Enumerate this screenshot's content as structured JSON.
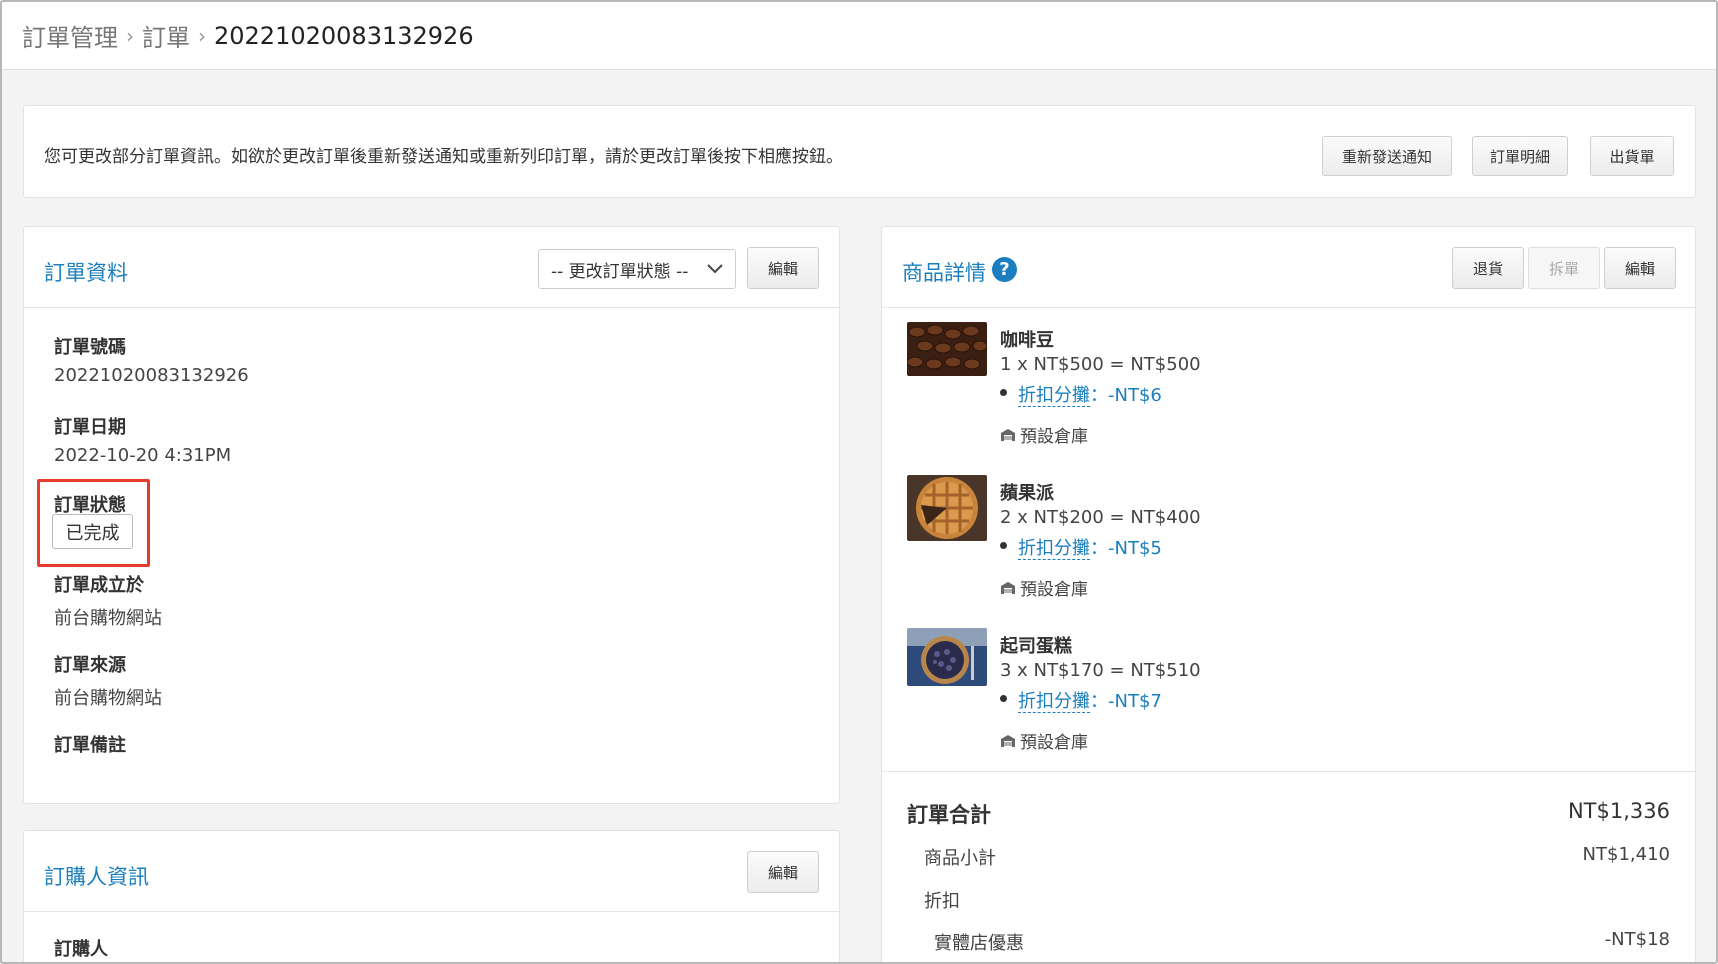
{
  "breadcrumb": {
    "items": [
      "訂單管理",
      "訂單"
    ],
    "current": "20221020083132926"
  },
  "notice": {
    "text": "您可更改部分訂單資訊。如欲於更改訂單後重新發送通知或重新列印訂單，請於更改訂單後按下相應按鈕。",
    "buttons": {
      "resend": "重新發送通知",
      "details": "訂單明細",
      "shipping": "出貨單"
    }
  },
  "order_info": {
    "title": "訂單資料",
    "status_select": "-- 更改訂單狀態 --",
    "edit_label": "編輯",
    "fields": {
      "number_label": "訂單號碼",
      "number_value": "20221020083132926",
      "date_label": "訂單日期",
      "date_value": "2022-10-20 4:31PM",
      "status_label": "訂單狀態",
      "status_value": "已完成",
      "created_label": "訂單成立於",
      "created_value": "前台購物網站",
      "source_label": "訂單來源",
      "source_value": "前台購物網站",
      "remark_label": "訂單備註"
    }
  },
  "buyer_info": {
    "title": "訂購人資訊",
    "edit_label": "編輯",
    "buyer_label": "訂購人"
  },
  "products": {
    "title": "商品詳情",
    "buttons": {
      "return": "退貨",
      "split": "拆單",
      "edit": "編輯"
    },
    "items": [
      {
        "name": "咖啡豆",
        "calc": "1 x NT$500 = NT$500",
        "discount_label": "折扣分攤",
        "discount_value": "：-NT$6",
        "warehouse": "預設倉庫",
        "thumb": "coffee-beans"
      },
      {
        "name": "蘋果派",
        "calc": "2 x NT$200 = NT$400",
        "discount_label": "折扣分攤",
        "discount_value": "：-NT$5",
        "warehouse": "預設倉庫",
        "thumb": "apple-pie"
      },
      {
        "name": "起司蛋糕",
        "calc": "3 x NT$170 = NT$510",
        "discount_label": "折扣分攤",
        "discount_value": "：-NT$7",
        "warehouse": "預設倉庫",
        "thumb": "cheesecake"
      }
    ]
  },
  "summary": {
    "total_label": "訂單合計",
    "total_value": "NT$1,336",
    "subtotal_label": "商品小計",
    "subtotal_value": "NT$1,410",
    "discount_label": "折扣",
    "store_discount_label": "實體店優惠",
    "store_discount_value": "-NT$18"
  },
  "colors": {
    "accent": "#1b7fbf",
    "highlight": "#e63c2c"
  }
}
